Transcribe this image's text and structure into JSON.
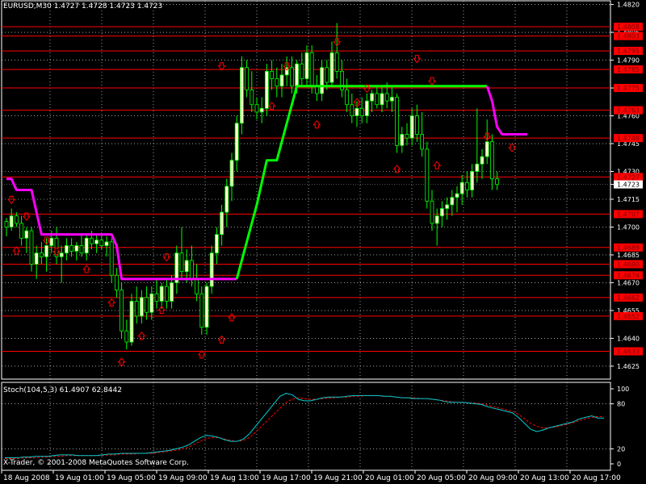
{
  "window": {
    "symbol_line": "EURUSD,M30  1.4727 1.4728 1.4723 1.4723",
    "indicator_line": "Stoch(104,5,3) 61.4907 62.8442",
    "copyright": "X-Trader, © 2001-2008 MetaQuotes Software Corp."
  },
  "colors": {
    "background": "#000000",
    "grid": "#ffffff",
    "candle_up": "#ffffcc",
    "candle_down": "#000000",
    "wick": "#00ff00",
    "level_line": "#ff0000",
    "level_label_bg": "#ff0000",
    "level_label_text": "#800000",
    "trend_up": "#00ff00",
    "trend_down": "#ff00ff",
    "arrow": "#ff0000",
    "stoch_main": "#00ced1",
    "stoch_signal": "#ff0000"
  },
  "chart_data": [
    {
      "type": "candlestick",
      "symbol": "EURUSD",
      "timeframe": "M30",
      "ylim": [
        1.4618,
        1.4822
      ],
      "price_ticks": [
        "1.4820",
        "1.4805",
        "1.4790",
        "1.4775",
        "1.4760",
        "1.4745",
        "1.4730",
        "1.4723",
        "1.4715",
        "1.4700",
        "1.4685",
        "1.4670",
        "1.4655",
        "1.4640",
        "1.4625"
      ],
      "current_price": "1.4723",
      "time_labels": [
        "18 Aug 2008",
        "19 Aug 01:00",
        "19 Aug 05:00",
        "19 Aug 09:00",
        "19 Aug 13:00",
        "19 Aug 17:00",
        "19 Aug 21:00",
        "20 Aug 01:00",
        "20 Aug 05:00",
        "20 Aug 09:00",
        "20 Aug 13:00",
        "20 Aug 17:00"
      ],
      "horizontal_levels": [
        "1.4808",
        "1.4803",
        "1.4795",
        "1.4785",
        "1.4775",
        "1.4763",
        "1.4748",
        "1.4727",
        "1.4707",
        "1.4689",
        "1.4680",
        "1.4674",
        "1.4662",
        "1.4652",
        "1.4633"
      ],
      "candles": [
        [
          1.4703,
          1.4705,
          1.4695,
          1.47
        ],
        [
          1.47,
          1.471,
          1.4698,
          1.4706
        ],
        [
          1.4706,
          1.4708,
          1.47,
          1.4702
        ],
        [
          1.4702,
          1.4706,
          1.469,
          1.4694
        ],
        [
          1.4694,
          1.47,
          1.4686,
          1.4698
        ],
        [
          1.4698,
          1.47,
          1.4676,
          1.468
        ],
        [
          1.468,
          1.469,
          1.4672,
          1.4686
        ],
        [
          1.4686,
          1.4692,
          1.468,
          1.4684
        ],
        [
          1.4684,
          1.4694,
          1.4676,
          1.469
        ],
        [
          1.469,
          1.4698,
          1.4686,
          1.4694
        ],
        [
          1.4694,
          1.47,
          1.468,
          1.4684
        ],
        [
          1.4684,
          1.469,
          1.467,
          1.4686
        ],
        [
          1.4686,
          1.4694,
          1.4682,
          1.469
        ],
        [
          1.469,
          1.4694,
          1.4684,
          1.4687
        ],
        [
          1.4687,
          1.4692,
          1.4682,
          1.469
        ],
        [
          1.469,
          1.4696,
          1.4684,
          1.4686
        ],
        [
          1.4686,
          1.4696,
          1.4682,
          1.4694
        ],
        [
          1.4694,
          1.4698,
          1.4688,
          1.4691
        ],
        [
          1.4691,
          1.4696,
          1.4686,
          1.4693
        ],
        [
          1.4693,
          1.4697,
          1.4688,
          1.469
        ],
        [
          1.469,
          1.4695,
          1.4684,
          1.4692
        ],
        [
          1.4692,
          1.4694,
          1.467,
          1.4674
        ],
        [
          1.4674,
          1.4678,
          1.4662,
          1.4666
        ],
        [
          1.4666,
          1.467,
          1.464,
          1.4644
        ],
        [
          1.4644,
          1.465,
          1.4634,
          1.4638
        ],
        [
          1.4638,
          1.4664,
          1.4636,
          1.466
        ],
        [
          1.466,
          1.4668,
          1.4648,
          1.4652
        ],
        [
          1.4652,
          1.4666,
          1.4648,
          1.4662
        ],
        [
          1.4662,
          1.4668,
          1.465,
          1.4654
        ],
        [
          1.4654,
          1.4668,
          1.465,
          1.4664
        ],
        [
          1.4664,
          1.4672,
          1.4656,
          1.466
        ],
        [
          1.466,
          1.467,
          1.4656,
          1.4668
        ],
        [
          1.4668,
          1.4672,
          1.4656,
          1.466
        ],
        [
          1.466,
          1.4674,
          1.4656,
          1.467
        ],
        [
          1.467,
          1.469,
          1.4664,
          1.4686
        ],
        [
          1.4686,
          1.47,
          1.4672,
          1.4676
        ],
        [
          1.4676,
          1.4688,
          1.467,
          1.4682
        ],
        [
          1.4682,
          1.469,
          1.4668,
          1.4672
        ],
        [
          1.4672,
          1.468,
          1.466,
          1.4664
        ],
        [
          1.4664,
          1.4668,
          1.4642,
          1.4646
        ],
        [
          1.4646,
          1.467,
          1.4642,
          1.4668
        ],
        [
          1.4668,
          1.469,
          1.4664,
          1.4686
        ],
        [
          1.4686,
          1.47,
          1.468,
          1.4696
        ],
        [
          1.4696,
          1.4712,
          1.469,
          1.4708
        ],
        [
          1.4708,
          1.4726,
          1.47,
          1.4722
        ],
        [
          1.4722,
          1.474,
          1.4714,
          1.4736
        ],
        [
          1.4736,
          1.476,
          1.473,
          1.4756
        ],
        [
          1.4756,
          1.4792,
          1.475,
          1.4786
        ],
        [
          1.4786,
          1.479,
          1.477,
          1.4774
        ],
        [
          1.4774,
          1.4784,
          1.4762,
          1.4766
        ],
        [
          1.4766,
          1.477,
          1.4758,
          1.4762
        ],
        [
          1.4762,
          1.477,
          1.4756,
          1.4764
        ],
        [
          1.4764,
          1.4788,
          1.476,
          1.4784
        ],
        [
          1.4784,
          1.479,
          1.4774,
          1.478
        ],
        [
          1.478,
          1.4786,
          1.477,
          1.4776
        ],
        [
          1.4776,
          1.4788,
          1.477,
          1.4782
        ],
        [
          1.4782,
          1.4792,
          1.4776,
          1.4786
        ],
        [
          1.4786,
          1.4792,
          1.4772,
          1.4776
        ],
        [
          1.4776,
          1.479,
          1.4772,
          1.4788
        ],
        [
          1.4788,
          1.4794,
          1.4776,
          1.478
        ],
        [
          1.478,
          1.4798,
          1.4776,
          1.4794
        ],
        [
          1.4794,
          1.4798,
          1.4772,
          1.4776
        ],
        [
          1.4776,
          1.4782,
          1.4768,
          1.4772
        ],
        [
          1.4772,
          1.479,
          1.4768,
          1.4786
        ],
        [
          1.4786,
          1.479,
          1.4774,
          1.4778
        ],
        [
          1.4778,
          1.48,
          1.4776,
          1.4794
        ],
        [
          1.4794,
          1.481,
          1.478,
          1.4784
        ],
        [
          1.4784,
          1.479,
          1.477,
          1.4774
        ],
        [
          1.4774,
          1.478,
          1.4762,
          1.4766
        ],
        [
          1.4766,
          1.4772,
          1.4756,
          1.476
        ],
        [
          1.476,
          1.4768,
          1.4754,
          1.4764
        ],
        [
          1.4764,
          1.477,
          1.4756,
          1.476
        ],
        [
          1.476,
          1.4772,
          1.4756,
          1.4768
        ],
        [
          1.4768,
          1.4774,
          1.4762,
          1.4772
        ],
        [
          1.4772,
          1.4776,
          1.4764,
          1.4766
        ],
        [
          1.4766,
          1.4776,
          1.4762,
          1.4772
        ],
        [
          1.4772,
          1.4778,
          1.4764,
          1.4768
        ],
        [
          1.4768,
          1.4776,
          1.4762,
          1.477
        ],
        [
          1.477,
          1.4772,
          1.474,
          1.4744
        ],
        [
          1.4744,
          1.4754,
          1.474,
          1.475
        ],
        [
          1.475,
          1.4756,
          1.4744,
          1.4748
        ],
        [
          1.4748,
          1.4764,
          1.4744,
          1.476
        ],
        [
          1.476,
          1.4766,
          1.4746,
          1.475
        ],
        [
          1.475,
          1.4762,
          1.4738,
          1.4742
        ],
        [
          1.4742,
          1.4746,
          1.471,
          1.4714
        ],
        [
          1.4714,
          1.472,
          1.4698,
          1.4702
        ],
        [
          1.4702,
          1.471,
          1.469,
          1.4706
        ],
        [
          1.4706,
          1.4714,
          1.47,
          1.471
        ],
        [
          1.471,
          1.4716,
          1.4704,
          1.4712
        ],
        [
          1.4712,
          1.472,
          1.4706,
          1.4716
        ],
        [
          1.4716,
          1.4722,
          1.4708,
          1.4718
        ],
        [
          1.4718,
          1.4728,
          1.4712,
          1.4724
        ],
        [
          1.4724,
          1.473,
          1.4716,
          1.472
        ],
        [
          1.472,
          1.4734,
          1.4716,
          1.473
        ],
        [
          1.473,
          1.4764,
          1.4724,
          1.4734
        ],
        [
          1.4734,
          1.4742,
          1.4726,
          1.4738
        ],
        [
          1.4738,
          1.4758,
          1.4734,
          1.4746
        ],
        [
          1.4746,
          1.475,
          1.472,
          1.4726
        ],
        [
          1.4726,
          1.473,
          1.472,
          1.4723
        ]
      ],
      "trend_line": [
        1.4726,
        1.4726,
        1.472,
        1.472,
        1.472,
        1.472,
        1.4708,
        1.4708,
        1.4696,
        1.4696,
        1.4696,
        1.4696,
        1.4696,
        1.4696,
        1.4696,
        1.4696,
        1.4696,
        1.4696,
        1.4696,
        1.4696,
        1.4696,
        1.4696,
        1.4696,
        1.4696,
        1.4696,
        1.4696,
        1.4696,
        1.4696,
        1.4696,
        1.4696,
        1.4696,
        1.4696,
        1.4696,
        1.4696,
        1.4696,
        1.4696,
        1.4696,
        1.4696,
        1.4696,
        1.4696,
        1.4696,
        1.4696,
        1.4696,
        1.4696,
        1.4696,
        1.4696,
        1.4696,
        1.4696,
        1.4696,
        1.4696,
        1.4696,
        1.4696,
        1.4696,
        1.4696,
        1.4696,
        1.4696,
        1.4696,
        1.4696,
        1.4696,
        1.4696,
        1.4696,
        1.4696,
        1.4696,
        1.4696,
        1.4696,
        1.4696,
        1.4696,
        1.4696,
        1.4696,
        1.4696,
        1.4696,
        1.4696,
        1.4696,
        1.4696,
        1.4696,
        1.4696,
        1.4696,
        1.4696,
        1.4696,
        1.4696,
        1.4696,
        1.4696,
        1.4696,
        1.4696,
        1.4696,
        1.4696,
        1.4696,
        1.4696,
        1.4696,
        1.4696,
        1.4696,
        1.4696,
        1.4696,
        1.4696,
        1.4696,
        1.4696,
        1.4696,
        1.4696,
        1.4696,
        1.4696,
        1.4696,
        1.4696,
        1.4696
      ],
      "trend_segments": [
        {
          "color": "trend_down",
          "points": [
            [
              0,
              1.4726
            ],
            [
              1,
              1.4726
            ],
            [
              2,
              1.472
            ],
            [
              3,
              1.472
            ],
            [
              4,
              1.472
            ],
            [
              5,
              1.472
            ],
            [
              6,
              1.4708
            ],
            [
              7,
              1.4696
            ],
            [
              8,
              1.4696
            ],
            [
              20,
              1.4696
            ],
            [
              21,
              1.4696
            ],
            [
              22,
              1.469
            ],
            [
              23,
              1.4672
            ],
            [
              46,
              1.4672
            ]
          ]
        },
        {
          "color": "trend_up",
          "points": [
            [
              46,
              1.4672
            ],
            [
              48,
              1.4692
            ],
            [
              50,
              1.4712
            ],
            [
              52,
              1.4736
            ],
            [
              54,
              1.4736
            ],
            [
              56,
              1.4756
            ],
            [
              58,
              1.4776
            ],
            [
              60,
              1.4776
            ],
            [
              96,
              1.4776
            ]
          ]
        },
        {
          "color": "trend_down",
          "points": [
            [
              96,
              1.4776
            ],
            [
              97,
              1.4768
            ],
            [
              98,
              1.4754
            ],
            [
              99,
              1.475
            ],
            [
              104,
              1.475
            ]
          ]
        }
      ],
      "arrow_down_at": [
        [
          1,
          1.4714
        ],
        [
          4,
          1.4705
        ],
        [
          8,
          1.4692
        ],
        [
          10,
          1.4686
        ],
        [
          32,
          1.4683
        ],
        [
          43,
          1.4786
        ],
        [
          56,
          1.4786
        ],
        [
          66,
          1.4799
        ],
        [
          72,
          1.4774
        ],
        [
          82,
          1.479
        ],
        [
          85,
          1.4778
        ],
        [
          96,
          1.4748
        ],
        [
          101,
          1.4742
        ]
      ],
      "arrow_up_at": [
        [
          2,
          1.4688
        ],
        [
          16,
          1.4678
        ],
        [
          21,
          1.466
        ],
        [
          23,
          1.4628
        ],
        [
          27,
          1.4642
        ],
        [
          31,
          1.4656
        ],
        [
          39,
          1.4632
        ],
        [
          43,
          1.464
        ],
        [
          45,
          1.4652
        ],
        [
          53,
          1.4766
        ],
        [
          62,
          1.4756
        ],
        [
          70,
          1.4768
        ],
        [
          78,
          1.4732
        ],
        [
          86,
          1.4734
        ]
      ]
    },
    {
      "type": "line",
      "name": "Stoch(104,5,3)",
      "ylim": [
        0,
        100
      ],
      "y_ticks": [
        "100",
        "80",
        "20",
        "0"
      ],
      "series": [
        {
          "name": "main",
          "values": [
            8,
            8,
            8,
            9,
            9,
            10,
            10,
            10,
            11,
            12,
            12,
            12,
            11,
            11,
            11,
            11,
            12,
            13,
            13,
            14,
            14,
            14,
            14,
            14,
            15,
            16,
            17,
            18,
            20,
            22,
            25,
            30,
            35,
            38,
            37,
            35,
            32,
            30,
            30,
            33,
            40,
            50,
            60,
            70,
            80,
            90,
            94,
            92,
            86,
            84,
            84,
            86,
            88,
            89,
            89,
            89,
            90,
            91,
            91,
            91,
            91,
            91,
            90,
            90,
            89,
            88,
            88,
            87,
            87,
            87,
            86,
            85,
            83,
            82,
            82,
            82,
            81,
            80,
            79,
            76,
            74,
            72,
            70,
            68,
            62,
            54,
            46,
            43,
            45,
            48,
            50,
            52,
            54,
            56,
            60,
            62,
            64,
            61,
            61
          ]
        },
        {
          "name": "signal",
          "values": [
            7,
            7,
            7,
            8,
            8,
            8,
            9,
            9,
            10,
            10,
            11,
            11,
            11,
            11,
            11,
            11,
            11,
            12,
            12,
            13,
            13,
            13,
            14,
            14,
            14,
            15,
            16,
            17,
            18,
            20,
            22,
            26,
            30,
            34,
            35,
            35,
            33,
            31,
            30,
            31,
            35,
            42,
            50,
            58,
            66,
            74,
            82,
            86,
            88,
            87,
            86,
            86,
            87,
            88,
            88,
            89,
            89,
            90,
            90,
            91,
            91,
            91,
            90,
            90,
            89,
            88,
            88,
            88,
            87,
            87,
            86,
            85,
            84,
            83,
            82,
            82,
            81,
            81,
            80,
            78,
            76,
            74,
            72,
            70,
            66,
            60,
            54,
            50,
            48,
            48,
            49,
            51,
            53,
            55,
            58,
            60,
            62,
            63,
            63
          ]
        }
      ],
      "values_latest": [
        "61.4907",
        "62.8442"
      ]
    }
  ]
}
